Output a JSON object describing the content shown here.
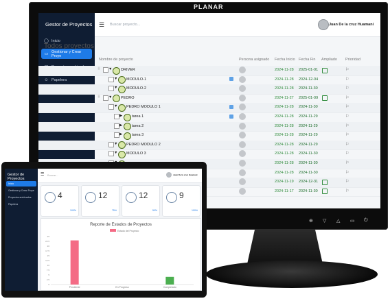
{
  "monitor": {
    "brand": "PLANAR",
    "controls": [
      "⊕",
      "▽",
      "△",
      "▭",
      "⏻"
    ],
    "sidebar": {
      "title": "Gestor de Proyectos",
      "items": [
        {
          "icon": "home-icon",
          "glyph": "◯",
          "label": "Inicio",
          "active": false
        },
        {
          "icon": "folder-icon",
          "glyph": "▭",
          "label": "Gestionar y Crear Proye",
          "active": true
        },
        {
          "icon": "archive-icon",
          "glyph": "▤",
          "label": "Proyectos archivados",
          "active": false
        },
        {
          "icon": "user-icon",
          "glyph": "☺",
          "label": "Papelera",
          "active": false
        }
      ]
    },
    "topbar": {
      "search_placeholder": "Buscar proyecto...",
      "user_name": "Juan De la cruz Huamani"
    },
    "page_title": "Todos proyectos",
    "columns": [
      "Nombre de proyecto",
      "Persona asignado",
      "Fecha Inicio",
      "Fecha Fin",
      "Ampliado",
      "Prioridad"
    ],
    "rows": [
      {
        "level": 0,
        "name": "DRIVER",
        "start": "2024-11-28",
        "end": "2025-01-01",
        "ampliado": true,
        "blue": false
      },
      {
        "level": 1,
        "name": "MODULO-1",
        "start": "2024-11-28",
        "end": "2024-12-04",
        "ampliado": false,
        "blue": true
      },
      {
        "level": 1,
        "name": "MODULO-2",
        "start": "2024-11-28",
        "end": "2024-11-30",
        "ampliado": false,
        "blue": false
      },
      {
        "level": 0,
        "name": "PEDRO",
        "start": "2024-11-27",
        "end": "2025-01-09",
        "ampliado": true,
        "blue": false
      },
      {
        "level": 1,
        "name": "PEDRO MODULO 1",
        "start": "2024-11-28",
        "end": "2024-11-30",
        "ampliado": false,
        "blue": true
      },
      {
        "level": 2,
        "name": "tarea 1",
        "start": "2024-11-28",
        "end": "2024-11-29",
        "ampliado": false,
        "blue": true
      },
      {
        "level": 2,
        "name": "tarea 2",
        "start": "2024-11-28",
        "end": "2024-11-29",
        "ampliado": false,
        "blue": false
      },
      {
        "level": 2,
        "name": "tarea 3",
        "start": "2024-11-28",
        "end": "2024-11-29",
        "ampliado": false,
        "blue": false
      },
      {
        "level": 1,
        "name": "PEDRO MODULO 2",
        "start": "2024-11-28",
        "end": "2024-11-29",
        "ampliado": false,
        "blue": false
      },
      {
        "level": 1,
        "name": "MODULO 3",
        "start": "2024-11-28",
        "end": "2024-11-30",
        "ampliado": false,
        "blue": false
      },
      {
        "level": 1,
        "name": "",
        "start": "2024-11-28",
        "end": "2024-11-30",
        "ampliado": false,
        "blue": false
      },
      {
        "level": 1,
        "name": "",
        "start": "2024-11-28",
        "end": "2024-11-30",
        "ampliado": false,
        "blue": false
      },
      {
        "level": 1,
        "name": "",
        "start": "2024-11-19",
        "end": "2024-12-31",
        "ampliado": true,
        "blue": false
      },
      {
        "level": 1,
        "name": "",
        "start": "2024-11-17",
        "end": "2024-11-30",
        "ampliado": true,
        "blue": false
      }
    ]
  },
  "laptop": {
    "sidebar": {
      "title": "Gestor de Proyectos",
      "items": [
        {
          "label": "Inicio",
          "active": true
        },
        {
          "label": "Gestionar y Crear Proye",
          "active": false
        },
        {
          "label": "Proyectos archivados",
          "active": false
        },
        {
          "label": "Papelera",
          "active": false
        }
      ]
    },
    "topbar": {
      "search_placeholder": "Buscar...",
      "user_name": "Juan De la cruz Huamani"
    },
    "cards": [
      {
        "value": "4",
        "pct": "100%"
      },
      {
        "value": "12",
        "pct": "75%"
      },
      {
        "value": "12",
        "pct": "50%"
      },
      {
        "value": "9",
        "pct": "100%"
      }
    ]
  },
  "chart_data": {
    "type": "bar",
    "title": "Reporte de Estados de Proyectos",
    "legend": "Estado del Proyecto",
    "categories": [
      "Pendiente",
      "En Progreso",
      "Completado"
    ],
    "values": [
      23,
      0,
      4
    ],
    "colors": [
      "#f46b85",
      "#4a90d9",
      "#4caf50"
    ],
    "ylim": [
      0,
      25
    ],
    "yticks": [
      0,
      2.5,
      5,
      7.5,
      10,
      12.5,
      15,
      17.5,
      20,
      22.5,
      25
    ]
  }
}
